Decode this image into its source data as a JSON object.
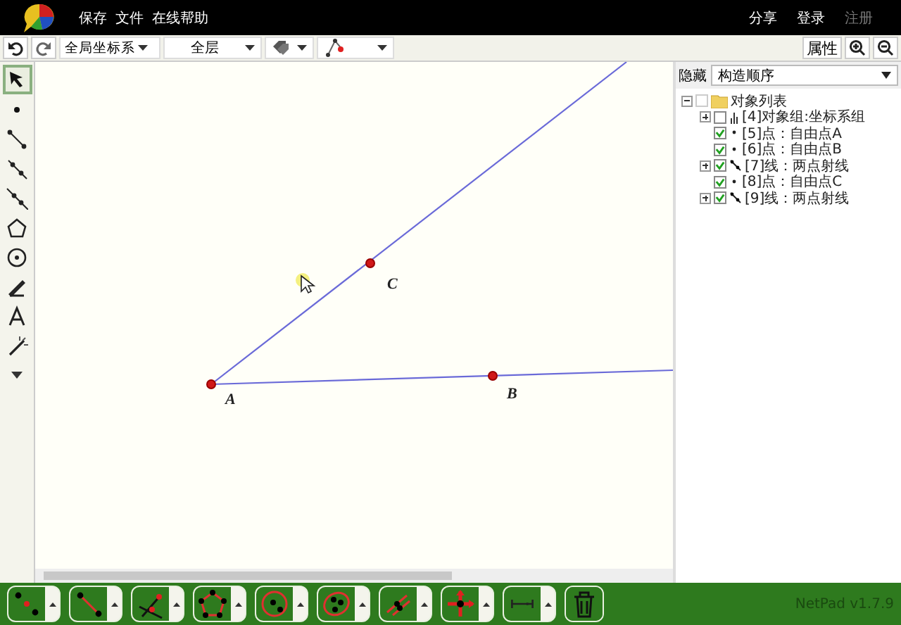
{
  "menu": {
    "left": [
      {
        "label": "保存"
      },
      {
        "label": "文件"
      },
      {
        "label": "在线帮助"
      }
    ],
    "right": [
      {
        "label": "分享",
        "disabled": false
      },
      {
        "label": "登录",
        "disabled": false
      },
      {
        "label": "注册",
        "disabled": true
      }
    ]
  },
  "toolbar": {
    "coordinate_system": "全局坐标系",
    "layer": "全层",
    "properties_button": "属性"
  },
  "tools": [
    {
      "kind": "select",
      "selected": true
    },
    {
      "kind": "point",
      "selected": false
    },
    {
      "kind": "segment",
      "selected": false
    },
    {
      "kind": "ray",
      "selected": false
    },
    {
      "kind": "line",
      "selected": false
    },
    {
      "kind": "polygon",
      "selected": false
    },
    {
      "kind": "circle",
      "selected": false
    },
    {
      "kind": "pen",
      "selected": false
    },
    {
      "kind": "text",
      "selected": false
    },
    {
      "kind": "wand",
      "selected": false
    },
    {
      "kind": "more",
      "selected": false
    }
  ],
  "canvas": {
    "points": [
      {
        "label": "A"
      },
      {
        "label": "B"
      },
      {
        "label": "C"
      }
    ]
  },
  "panel": {
    "hide_label": "隐藏",
    "order_select": "构造顺序",
    "tree": {
      "label": "对象列表",
      "expanded": true,
      "checked": false,
      "children": [
        {
          "label": "[4]对象组:坐标系组",
          "kind": "group",
          "checked": false,
          "expanded": false
        },
        {
          "label": "[5]点：自由点A",
          "kind": "point",
          "checked": true
        },
        {
          "label": "[6]点：自由点B",
          "kind": "point",
          "checked": true
        },
        {
          "label": "[7]线：两点射线",
          "kind": "line",
          "checked": true,
          "expanded": false
        },
        {
          "label": "[8]点：自由点C",
          "kind": "point",
          "checked": true
        },
        {
          "label": "[9]线：两点射线",
          "kind": "line",
          "checked": true,
          "expanded": false
        }
      ]
    }
  },
  "bottom_tools": [
    {
      "kind": "midpoint"
    },
    {
      "kind": "segment"
    },
    {
      "kind": "intersection"
    },
    {
      "kind": "polygon"
    },
    {
      "kind": "circle"
    },
    {
      "kind": "ellipse"
    },
    {
      "kind": "parallel"
    },
    {
      "kind": "move"
    },
    {
      "kind": "measure"
    },
    {
      "kind": "trash"
    }
  ],
  "version": "NetPad v1.7.9"
}
